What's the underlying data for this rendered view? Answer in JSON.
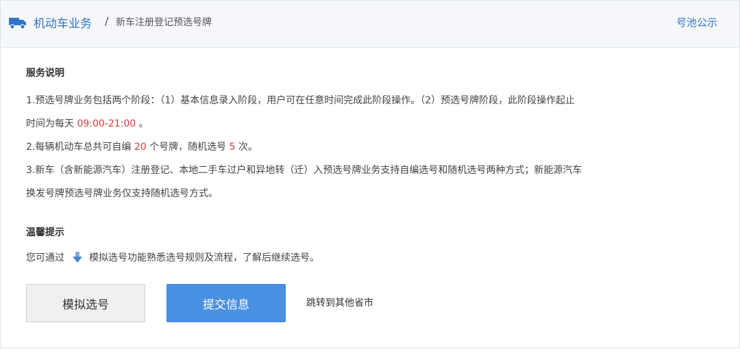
{
  "header": {
    "truck_icon": "truck-icon",
    "crumb_main": "机动车业务",
    "crumb_sep": "/",
    "crumb_current": "新车注册登记预选号牌",
    "pool_link": "号池公示"
  },
  "service": {
    "title": "服务说明",
    "item1_a": "1.预选号牌业务包括两个阶段：（1）基本信息录入阶段，用户可在任意时间完成此阶段操作。（2）预选号牌阶段，此阶段操作起止",
    "item1_b_pre": "时间为每天 ",
    "item1_time": "09:00-21:00",
    "item1_b_post": " 。",
    "item2_pre": "2.每辆机动车总共可自编 ",
    "item2_num": "20",
    "item2_mid": " 个号牌，随机选号 ",
    "item2_times": "5",
    "item2_post": " 次。",
    "item3_a": "3.新车（含新能源汽车）注册登记、本地二手车过户和异地转（迁）入预选号牌业务支持自编选号和随机选号两种方式；新能源汽车",
    "item3_b": "换发号牌预选号牌业务仅支持随机选号方式。"
  },
  "tips": {
    "title": "温馨提示",
    "text_pre": "您可通过",
    "arrow_icon": "download-arrow-icon",
    "text_post": "模拟选号功能熟悉选号规则及流程，了解后继续选号。"
  },
  "actions": {
    "simulate_label": "模拟选号",
    "submit_label": "提交信息",
    "jump_label": "跳转到其他省市"
  },
  "colors": {
    "accent": "#2f74c8",
    "submit_bg": "#4a90e2",
    "highlight": "#d43b3b"
  }
}
